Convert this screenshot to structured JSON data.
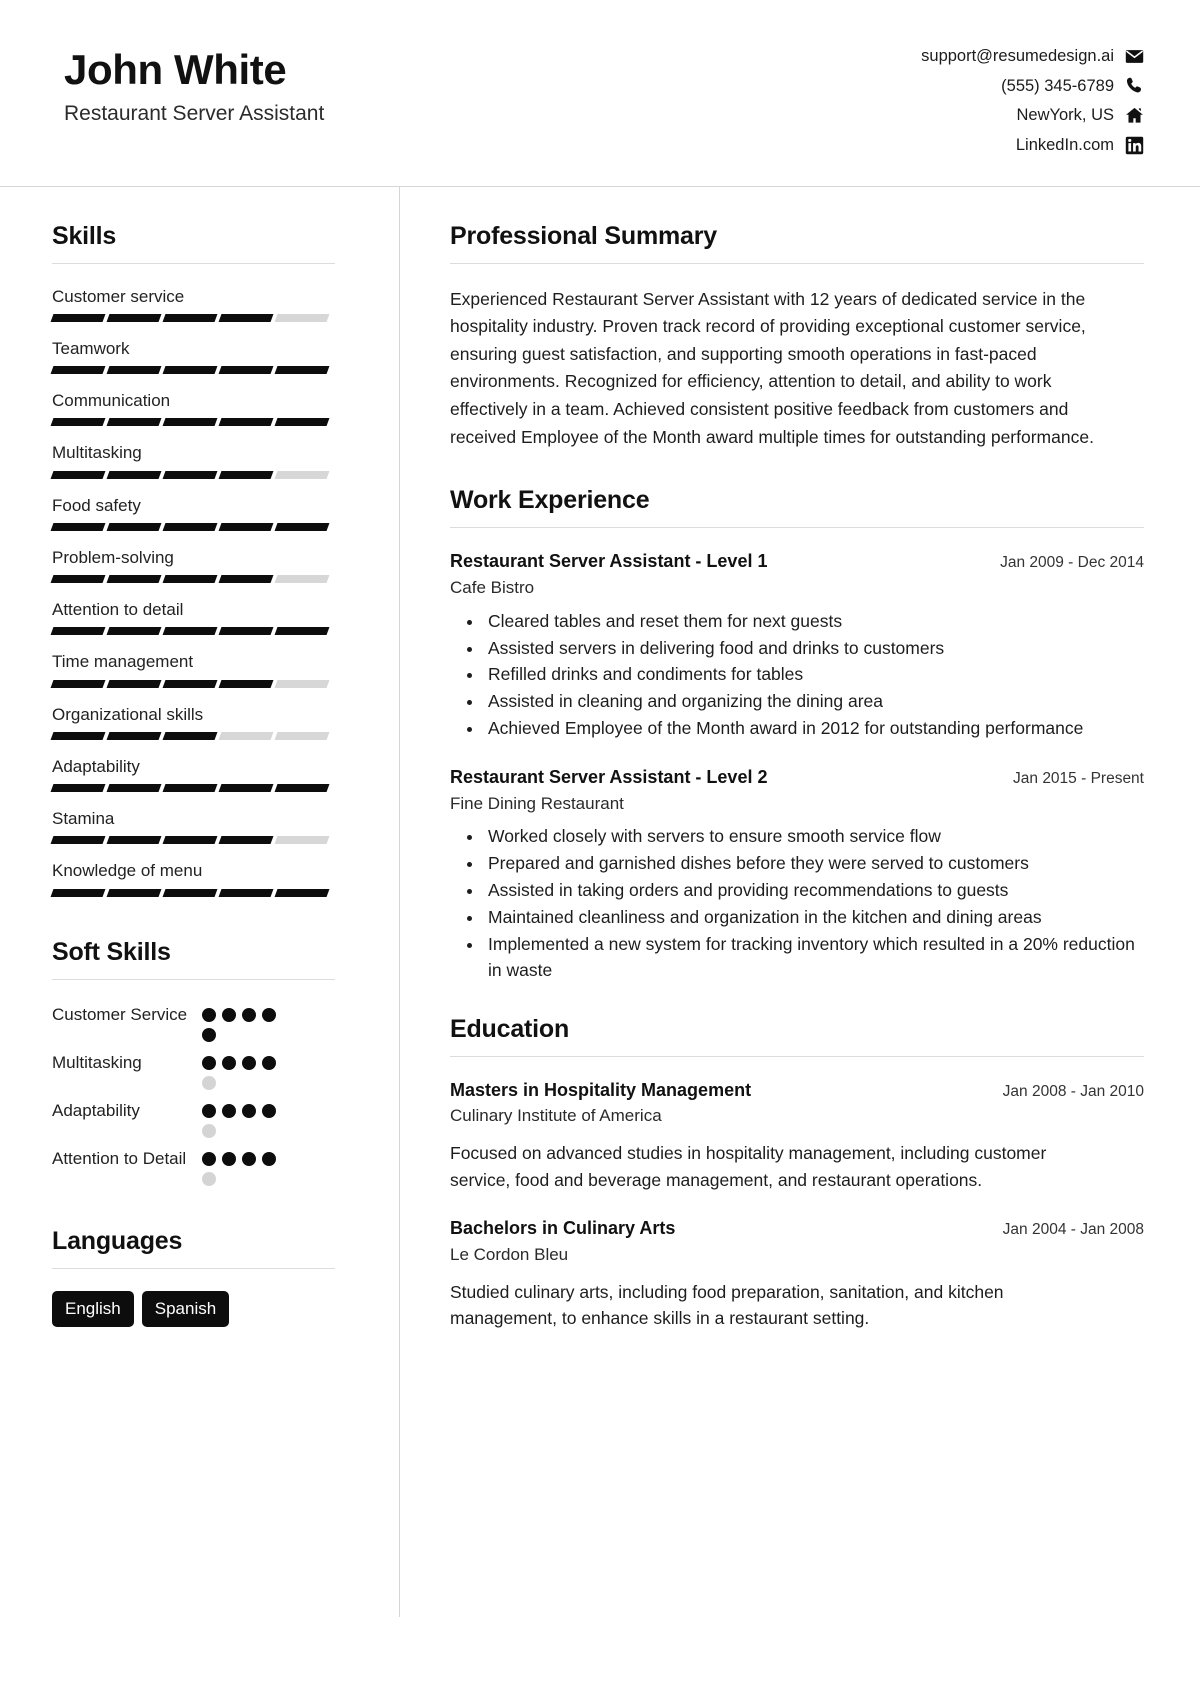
{
  "header": {
    "name": "John White",
    "job_title": "Restaurant Server Assistant",
    "contacts": [
      {
        "text": "support@resumedesign.ai",
        "icon": "envelope-icon"
      },
      {
        "text": "(555) 345-6789",
        "icon": "phone-icon"
      },
      {
        "text": "NewYork, US",
        "icon": "home-icon"
      },
      {
        "text": "LinkedIn.com",
        "icon": "linkedin-icon"
      }
    ]
  },
  "sidebar": {
    "skills": {
      "heading": "Skills",
      "max_level": 5,
      "items": [
        {
          "label": "Customer service",
          "level": 4
        },
        {
          "label": "Teamwork",
          "level": 5
        },
        {
          "label": "Communication",
          "level": 5
        },
        {
          "label": "Multitasking",
          "level": 4
        },
        {
          "label": "Food safety",
          "level": 5
        },
        {
          "label": "Problem-solving",
          "level": 4
        },
        {
          "label": "Attention to detail",
          "level": 5
        },
        {
          "label": "Time management",
          "level": 4
        },
        {
          "label": "Organizational skills",
          "level": 3
        },
        {
          "label": "Adaptability",
          "level": 5
        },
        {
          "label": "Stamina",
          "level": 4
        },
        {
          "label": "Knowledge of menu",
          "level": 5
        }
      ]
    },
    "soft_skills": {
      "heading": "Soft Skills",
      "max_level": 5,
      "items": [
        {
          "label": "Customer Service",
          "level": 5
        },
        {
          "label": "Multitasking",
          "level": 4
        },
        {
          "label": "Adaptability",
          "level": 4
        },
        {
          "label": "Attention to Detail",
          "level": 4
        }
      ]
    },
    "languages": {
      "heading": "Languages",
      "items": [
        "English",
        "Spanish"
      ]
    }
  },
  "main": {
    "summary": {
      "heading": "Professional Summary",
      "text": "Experienced Restaurant Server Assistant with 12 years of dedicated service in the hospitality industry. Proven track record of providing exceptional customer service, ensuring guest satisfaction, and supporting smooth operations in fast-paced environments. Recognized for efficiency, attention to detail, and ability to work effectively in a team. Achieved consistent positive feedback from customers and received Employee of the Month award multiple times for outstanding performance."
    },
    "work_experience": {
      "heading": "Work Experience",
      "entries": [
        {
          "title": "Restaurant Server Assistant - Level 1",
          "date": "Jan 2009 - Dec 2014",
          "organization": "Cafe Bistro",
          "bullets": [
            "Cleared tables and reset them for next guests",
            "Assisted servers in delivering food and drinks to customers",
            "Refilled drinks and condiments for tables",
            "Assisted in cleaning and organizing the dining area",
            "Achieved Employee of the Month award in 2012 for outstanding performance"
          ]
        },
        {
          "title": "Restaurant Server Assistant - Level 2",
          "date": "Jan 2015 - Present",
          "organization": "Fine Dining Restaurant",
          "bullets": [
            "Worked closely with servers to ensure smooth service flow",
            "Prepared and garnished dishes before they were served to customers",
            "Assisted in taking orders and providing recommendations to guests",
            "Maintained cleanliness and organization in the kitchen and dining areas",
            "Implemented a new system for tracking inventory which resulted in a 20% reduction in waste"
          ]
        }
      ]
    },
    "education": {
      "heading": "Education",
      "entries": [
        {
          "title": "Masters in Hospitality Management",
          "date": "Jan 2008 - Jan 2010",
          "organization": "Culinary Institute of America",
          "description": "Focused on advanced studies in hospitality management, including customer service, food and beverage management, and restaurant operations."
        },
        {
          "title": "Bachelors in Culinary Arts",
          "date": "Jan 2004 - Jan 2008",
          "organization": "Le Cordon Bleu",
          "description": "Studied culinary arts, including food preparation, sanitation, and kitchen management, to enhance skills in a restaurant setting."
        }
      ]
    }
  },
  "colors": {
    "filled": "#0d0d0d",
    "empty": "#d7d7d7",
    "rule": "#dcdcdc"
  }
}
